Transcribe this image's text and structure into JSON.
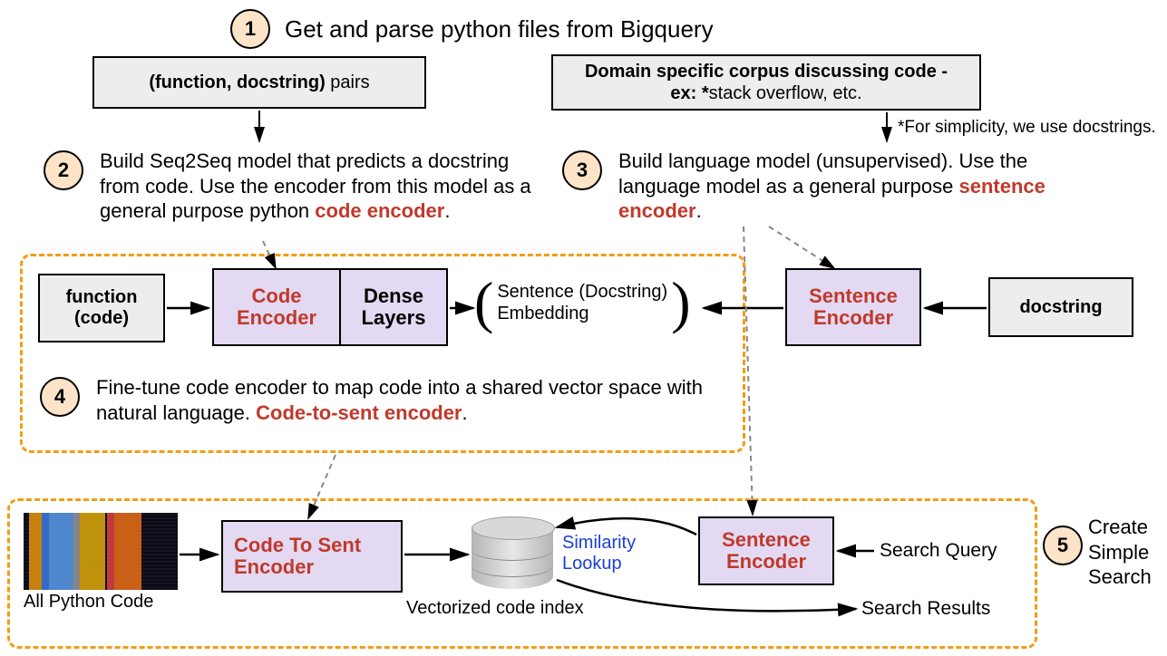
{
  "steps": {
    "s1": {
      "num": "1",
      "title": "Get and parse python files from Bigquery"
    },
    "s2": {
      "num": "2",
      "text_a": "Build Seq2Seq model that predicts a docstring from code. Use the encoder from this model as a general purpose python ",
      "text_hl": "code encoder",
      "text_b": "."
    },
    "s3": {
      "num": "3",
      "text_a": "Build language model (unsupervised).  Use the language model as a general purpose ",
      "text_hl": "sentence encoder",
      "text_b": "."
    },
    "s4": {
      "num": "4",
      "text_a": "Fine-tune code encoder to map code into a shared vector space with natural language.  ",
      "text_hl": "Code-to-sent encoder",
      "text_b": "."
    },
    "s5": {
      "num": "5",
      "line1": "Create",
      "line2": "Simple",
      "line3": "Search"
    }
  },
  "boxes": {
    "pairs_prefix": "(function, docstring)",
    "pairs_suffix": " pairs",
    "corpus_l1a": "Domain specific corpus discussing code -",
    "corpus_l2a": "ex: *",
    "corpus_l2b": "stack overflow, etc.",
    "footnote": "*For simplicity, we use docstrings.",
    "function_code_l1": "function",
    "function_code_l2": "(code)",
    "code_encoder_l1": "Code",
    "code_encoder_l2": "Encoder",
    "dense_l1": "Dense",
    "dense_l2": "Layers",
    "sentence_embed_l1": "Sentence (Docstring)",
    "sentence_embed_l2": "Embedding",
    "sentence_encoder_l1": "Sentence",
    "sentence_encoder_l2": "Encoder",
    "docstring": "docstring",
    "code_to_sent_l1": "Code To Sent",
    "code_to_sent_l2": "Encoder",
    "all_python_code": "All Python Code",
    "vectorized_index": "Vectorized code index",
    "similarity_l1": "Similarity",
    "similarity_l2": "Lookup",
    "search_query": "Search Query",
    "search_results": "Search Results"
  }
}
